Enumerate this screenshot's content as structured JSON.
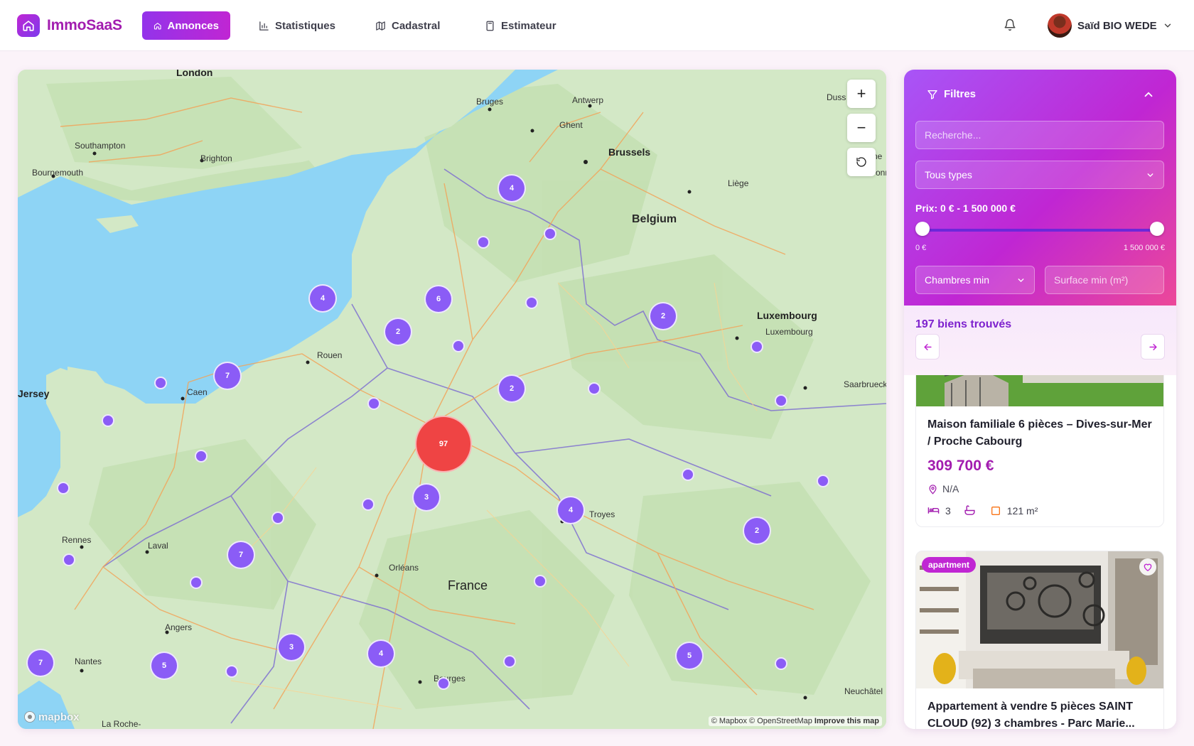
{
  "app": {
    "name": "ImmoSaaS"
  },
  "nav": [
    {
      "label": "Annonces",
      "icon": "home-icon",
      "active": true
    },
    {
      "label": "Statistiques",
      "icon": "bar-chart-icon",
      "active": false
    },
    {
      "label": "Cadastral",
      "icon": "map-icon",
      "active": false
    },
    {
      "label": "Estimateur",
      "icon": "calculator-icon",
      "active": false
    }
  ],
  "user": {
    "name": "Saïd BIO WEDE"
  },
  "map": {
    "labels": {
      "london": "London",
      "bruges": "Bruges",
      "antwerp": "Antwerp",
      "ghent": "Ghent",
      "brussels": "Brussels",
      "duss": "Duss",
      "southampton": "Southampton",
      "brighton": "Brighton",
      "bournemouth": "Bournemouth",
      "liege": "Liège",
      "belgium": "Belgium",
      "luxembourg_country": "Luxembourg",
      "luxembourg_city": "Luxembourg",
      "saarbrueck": "Saarbrueck",
      "rouen": "Rouen",
      "caen": "Caen",
      "jersey": "Jersey",
      "rennes": "Rennes",
      "laval": "Laval",
      "orleans": "Orléans",
      "france": "France",
      "troyes": "Troyes",
      "angers": "Angers",
      "nantes": "Nantes",
      "bourges": "Bourges",
      "neuchatel": "Neuchâtel",
      "la_roche": "La Roche-",
      "ne": "ne",
      "onn": "onn"
    },
    "clusters": [
      {
        "count": "4"
      },
      {
        "count": "4"
      },
      {
        "count": "6"
      },
      {
        "count": "2"
      },
      {
        "count": "7"
      },
      {
        "count": "2"
      },
      {
        "count": "2"
      },
      {
        "count": "97"
      },
      {
        "count": "3"
      },
      {
        "count": "4"
      },
      {
        "count": "2"
      },
      {
        "count": "7"
      },
      {
        "count": "7"
      },
      {
        "count": "5"
      },
      {
        "count": "3"
      },
      {
        "count": "4"
      },
      {
        "count": "5"
      }
    ],
    "zoom_in": "+",
    "zoom_out": "−",
    "mapbox_logo": "mapbox",
    "attribution": "© Mapbox © OpenStreetMap",
    "improve": "Improve this map"
  },
  "filters": {
    "title": "Filtres",
    "search_placeholder": "Recherche...",
    "type_select": "Tous types",
    "price_label": "Prix: 0 € - 1 500 000 €",
    "price_min": "0 €",
    "price_max": "1 500 000 €",
    "price_range_fraction": [
      0,
      1
    ],
    "bedrooms_select": "Chambres min",
    "surface_placeholder": "Surface min (m²)"
  },
  "results": {
    "count_label": "197 biens trouvés"
  },
  "listings": [
    {
      "title": "Maison familiale 6 pièces – Dives-sur-Mer / Proche Cabourg",
      "price": "309 700 €",
      "location": "N/A",
      "bedrooms": "3",
      "surface": "121 m²"
    },
    {
      "badge": "apartment",
      "title": "Appartement à vendre 5 pièces SAINT CLOUD (92) 3 chambres - Parc Marie..."
    }
  ],
  "colors": {
    "accent": "#a21caf",
    "cluster": "#8b5cf6",
    "cluster_large": "#ef4444"
  }
}
